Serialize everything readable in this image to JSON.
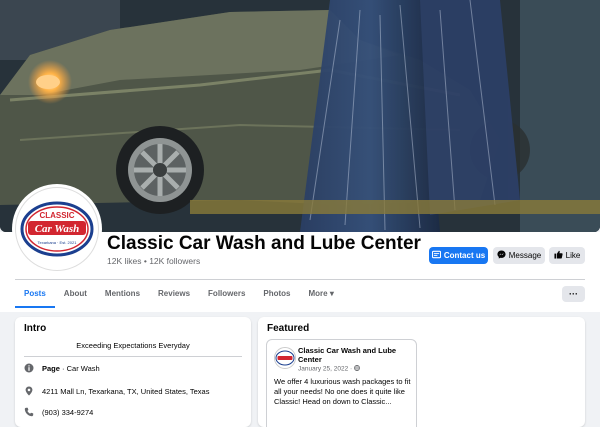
{
  "page": {
    "name": "Classic Car Wash and Lube Center",
    "stats": "12K likes • 12K followers"
  },
  "logo": {
    "line1": "CLASSIC",
    "line2": "Car Wash",
    "line3": "Texarkana · Est. 2021"
  },
  "actions": {
    "contact": "Contact us",
    "message": "Message",
    "like": "Like"
  },
  "tabs": [
    {
      "label": "Posts"
    },
    {
      "label": "About"
    },
    {
      "label": "Mentions"
    },
    {
      "label": "Reviews"
    },
    {
      "label": "Followers"
    },
    {
      "label": "Photos"
    },
    {
      "label": "More ▾"
    }
  ],
  "more_button": "···",
  "intro": {
    "title": "Intro",
    "tagline": "Exceeding Expectations Everyday",
    "page_label": "Page",
    "page_category": " · Car Wash",
    "address": "4211 Mall Ln, Texarkana, TX, United States, Texas",
    "phone": "(903) 334-9274"
  },
  "featured": {
    "title": "Featured",
    "post_author": "Classic Car Wash and Lube Center",
    "post_date": "January 25, 2022 · ",
    "post_text": "We offer 4 luxurious wash packages to fit all your needs! No one does it quite like Classic! Head on down to Classic..."
  },
  "colors": {
    "accent": "#1877f2",
    "logo_red": "#d22630",
    "logo_blue": "#1b3f8f"
  }
}
